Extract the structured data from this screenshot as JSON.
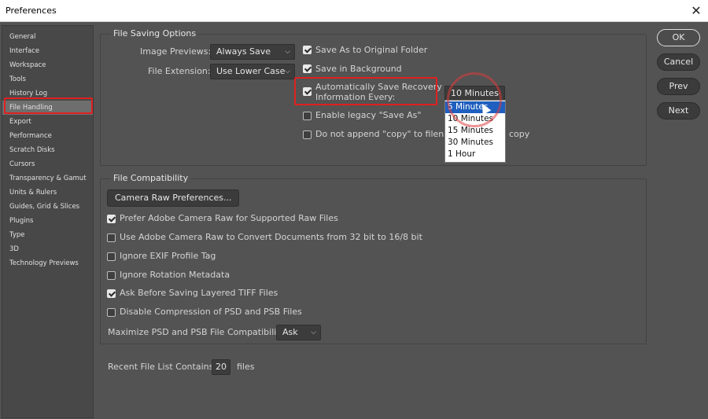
{
  "window": {
    "title": "Preferences",
    "close_glyph": "✕"
  },
  "sidebar": {
    "items": [
      {
        "label": "General"
      },
      {
        "label": "Interface"
      },
      {
        "label": "Workspace"
      },
      {
        "label": "Tools"
      },
      {
        "label": "History Log"
      },
      {
        "label": "File Handling",
        "active": true
      },
      {
        "label": "Export"
      },
      {
        "label": "Performance"
      },
      {
        "label": "Scratch Disks"
      },
      {
        "label": "Cursors"
      },
      {
        "label": "Transparency & Gamut"
      },
      {
        "label": "Units & Rulers"
      },
      {
        "label": "Guides, Grid & Slices"
      },
      {
        "label": "Plugins"
      },
      {
        "label": "Type"
      },
      {
        "label": "3D"
      },
      {
        "label": "Technology Previews"
      }
    ]
  },
  "file_saving": {
    "title": "File Saving Options",
    "image_previews": {
      "label": "Image Previews:",
      "value": "Always Save"
    },
    "file_extension": {
      "label": "File Extension:",
      "value": "Use Lower Case"
    },
    "save_as_original": {
      "label": "Save As to Original Folder",
      "checked": true
    },
    "save_in_background": {
      "label": "Save in Background",
      "checked": true
    },
    "auto_save": {
      "label_line1": "Automatically Save Recovery",
      "label_line2": "Information Every:",
      "checked": true
    },
    "auto_save_interval": {
      "value": "10 Minutes",
      "options": [
        "5 Minutes",
        "10 Minutes",
        "15 Minutes",
        "30 Minutes",
        "1 Hour"
      ],
      "highlighted": "5 Minutes"
    },
    "legacy_save_as": {
      "label": "Enable legacy \"Save As\"",
      "checked": false
    },
    "no_copy": {
      "label_start": "Do not append \"copy\" to filenam",
      "label_end": "copy",
      "checked": false
    }
  },
  "file_compat": {
    "title": "File Compatibility",
    "camera_raw_button": "Camera Raw Preferences...",
    "options": [
      {
        "label": "Prefer Adobe Camera Raw for Supported Raw Files",
        "checked": true
      },
      {
        "label": "Use Adobe Camera Raw to Convert Documents from 32 bit to 16/8 bit",
        "checked": false
      },
      {
        "label": "Ignore EXIF Profile Tag",
        "checked": false
      },
      {
        "label": "Ignore Rotation Metadata",
        "checked": false
      },
      {
        "label": "Ask Before Saving Layered TIFF Files",
        "checked": true
      },
      {
        "label": "Disable Compression of PSD and PSB Files",
        "checked": false
      }
    ],
    "maximize": {
      "label": "Maximize PSD and PSB File Compatibility:",
      "value": "Ask"
    }
  },
  "recent_files": {
    "label": "Recent File List Contains:",
    "value": "20",
    "suffix": "files"
  },
  "buttons": {
    "ok": "OK",
    "cancel": "Cancel",
    "prev": "Prev",
    "next": "Next"
  },
  "colors": {
    "panel": "#535353",
    "sidebar": "#484848",
    "highlight": "#1f5fbf",
    "annotation": "#e02020"
  }
}
